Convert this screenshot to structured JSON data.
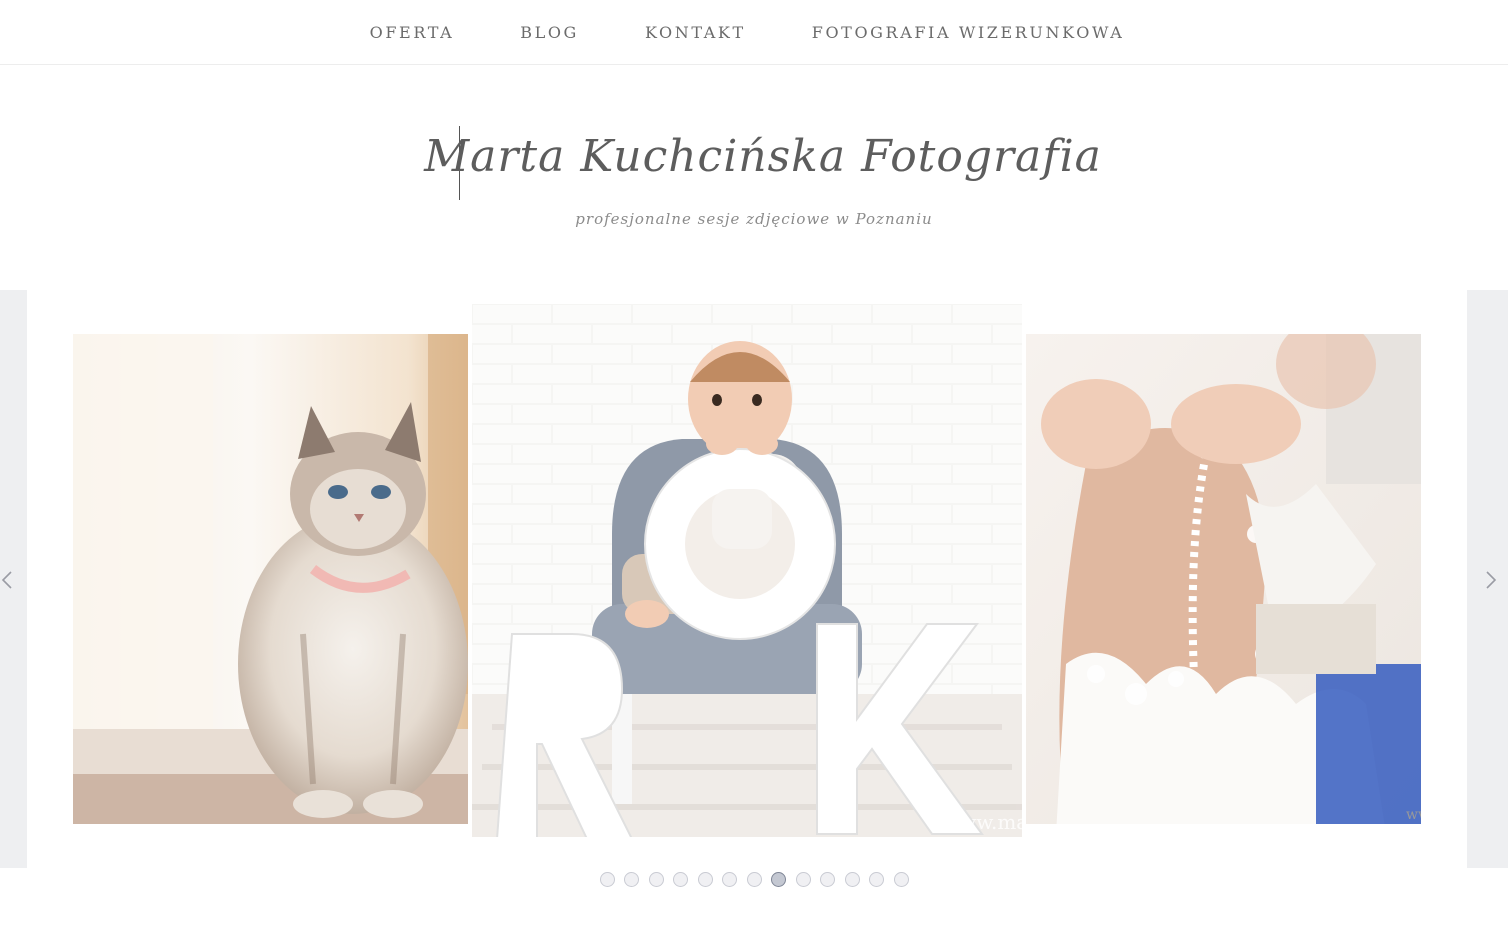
{
  "nav": {
    "items": [
      {
        "label": "OFERTA"
      },
      {
        "label": "BLOG"
      },
      {
        "label": "KONTAKT"
      },
      {
        "label": "FOTOGRAFIA WIZERUNKOWA"
      }
    ]
  },
  "brand": {
    "title": "Marta Kuchcińska Fotografia",
    "subtitle": "profesjonalne sesje zdjęciowe w Poznaniu"
  },
  "slider": {
    "slides": [
      {
        "icon": "cat-photo"
      },
      {
        "icon": "baby-photo",
        "watermark": "www.mart"
      },
      {
        "icon": "wedding-dress-photo",
        "watermark": "ww"
      }
    ],
    "dot_count": 13,
    "active_dot": 8,
    "prev_icon": "chevron-left-icon",
    "next_icon": "chevron-right-icon"
  },
  "colors": {
    "nav_text": "#6b6b6b",
    "subtitle_text": "#8b8b8b",
    "side_panel": "#eeeff1",
    "dot_active": "#c4c8d2"
  }
}
